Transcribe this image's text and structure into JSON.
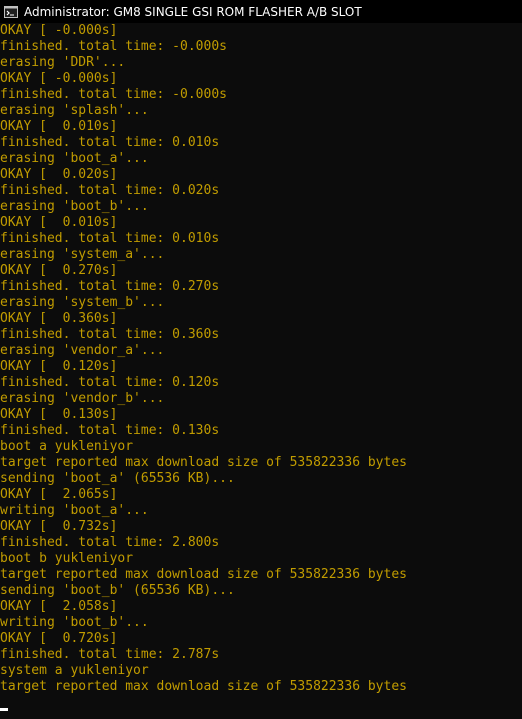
{
  "window": {
    "title": "Administrator:  GM8 SINGLE GSI ROM FLASHER A/B SLOT",
    "icon": "cmd-icon"
  },
  "colors": {
    "background": "#0c0c0c",
    "text": "#c19c00",
    "titlebar": "#000000",
    "cursor": "#ffffff"
  },
  "console": {
    "lines": [
      "OKAY [ -0.000s]",
      "finished. total time: -0.000s",
      "erasing 'DDR'...",
      "OKAY [ -0.000s]",
      "finished. total time: -0.000s",
      "erasing 'splash'...",
      "OKAY [  0.010s]",
      "finished. total time: 0.010s",
      "erasing 'boot_a'...",
      "OKAY [  0.020s]",
      "finished. total time: 0.020s",
      "erasing 'boot_b'...",
      "OKAY [  0.010s]",
      "finished. total time: 0.010s",
      "erasing 'system_a'...",
      "OKAY [  0.270s]",
      "finished. total time: 0.270s",
      "erasing 'system_b'...",
      "OKAY [  0.360s]",
      "finished. total time: 0.360s",
      "erasing 'vendor_a'...",
      "OKAY [  0.120s]",
      "finished. total time: 0.120s",
      "erasing 'vendor_b'...",
      "OKAY [  0.130s]",
      "finished. total time: 0.130s",
      "boot a yukleniyor",
      "target reported max download size of 535822336 bytes",
      "sending 'boot_a' (65536 KB)...",
      "OKAY [  2.065s]",
      "writing 'boot_a'...",
      "OKAY [  0.732s]",
      "finished. total time: 2.800s",
      "boot b yukleniyor",
      "target reported max download size of 535822336 bytes",
      "sending 'boot_b' (65536 KB)...",
      "OKAY [  2.058s]",
      "writing 'boot_b'...",
      "OKAY [  0.720s]",
      "finished. total time: 2.787s",
      "system a yukleniyor",
      "target reported max download size of 535822336 bytes"
    ]
  }
}
